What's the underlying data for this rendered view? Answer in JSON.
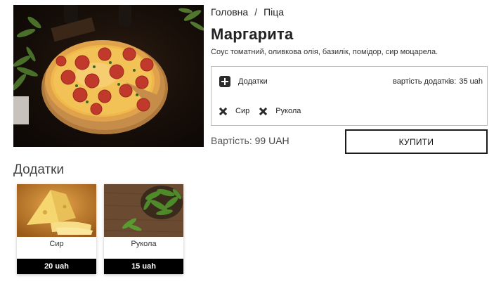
{
  "breadcrumb": {
    "home": "Головна",
    "separator": "/",
    "current": "Піца"
  },
  "product": {
    "title": "Маргарита",
    "description": "Соус томатний, оливкова олія, базилік, помідор, сир моцарела.",
    "price_label": "Вартість:",
    "price_value": "99 UAH",
    "buy_label": "КУПИТИ"
  },
  "addons_panel": {
    "toggle_label": "Додатки",
    "cost_label": "вартість додатків:",
    "cost_value": "35 uah",
    "selected": [
      {
        "label": "Сир",
        "icon": "remove-icon"
      },
      {
        "label": "Рукола",
        "icon": "remove-icon"
      }
    ]
  },
  "addons_section": {
    "title": "Додатки",
    "cards": [
      {
        "name": "Сир",
        "price": "20 uah"
      },
      {
        "name": "Рукола",
        "price": "15 uah"
      }
    ]
  },
  "colors": {
    "accent": "#000000",
    "border": "#bdbdbd",
    "text": "#222222"
  }
}
